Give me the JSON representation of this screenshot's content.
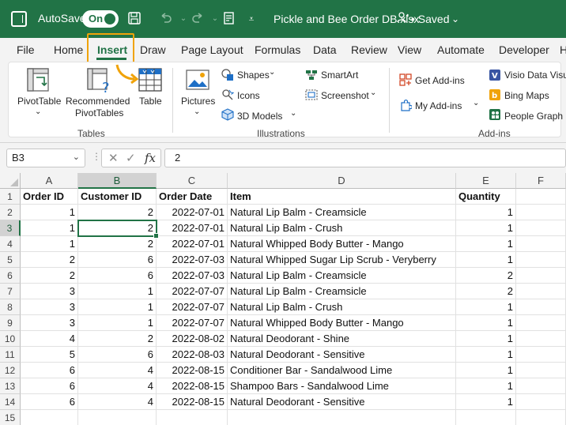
{
  "titlebar": {
    "autosave_label": "AutoSave",
    "autosave_toggle": "On",
    "filename": "Pickle and Bee Order DB.xlsx",
    "saved_label": "• Saved",
    "accent": "#217346"
  },
  "tabs": [
    "File",
    "Home",
    "Insert",
    "Draw",
    "Page Layout",
    "Formulas",
    "Data",
    "Review",
    "View",
    "Automate",
    "Developer",
    "He"
  ],
  "active_tab": "Insert",
  "ribbon": {
    "tables_group": {
      "label": "Tables",
      "pivottable": "PivotTable",
      "recommended_line1": "Recommended",
      "recommended_line2": "PivotTables",
      "table": "Table"
    },
    "illustrations_group": {
      "label": "Illustrations",
      "pictures": "Pictures",
      "shapes": "Shapes",
      "icons": "Icons",
      "models_3d": "3D Models",
      "smartart": "SmartArt",
      "screenshot": "Screenshot"
    },
    "addins_group": {
      "label": "Add-ins",
      "get_addins": "Get Add-ins",
      "my_addins": "My Add-ins",
      "visio": "Visio Data Visu",
      "bing_maps": "Bing Maps",
      "people_graph": "People Graph"
    }
  },
  "formula_bar": {
    "name_box": "B3",
    "formula_value": "2",
    "fx_label": "fx"
  },
  "sheet": {
    "columns": [
      "A",
      "B",
      "C",
      "D",
      "E",
      "F"
    ],
    "selected_column": "B",
    "selected_row": "3",
    "row_numbers": [
      "1",
      "2",
      "3",
      "4",
      "5",
      "6",
      "7",
      "8",
      "9",
      "10",
      "11",
      "12",
      "13",
      "14",
      "15"
    ],
    "headers": [
      "Order ID",
      "Customer ID",
      "Order Date",
      "Item",
      "Quantity"
    ],
    "rows": [
      [
        "1",
        "2",
        "2022-07-01",
        "Natural Lip Balm - Creamsicle",
        "1"
      ],
      [
        "1",
        "2",
        "2022-07-01",
        "Natural Lip Balm - Crush",
        "1"
      ],
      [
        "1",
        "2",
        "2022-07-01",
        "Natural Whipped Body Butter - Mango",
        "1"
      ],
      [
        "2",
        "6",
        "2022-07-03",
        "Natural Whipped Sugar Lip Scrub - Veryberry",
        "1"
      ],
      [
        "2",
        "6",
        "2022-07-03",
        "Natural Lip Balm - Creamsicle",
        "2"
      ],
      [
        "3",
        "1",
        "2022-07-07",
        "Natural Lip Balm - Creamsicle",
        "2"
      ],
      [
        "3",
        "1",
        "2022-07-07",
        "Natural Lip Balm - Crush",
        "1"
      ],
      [
        "3",
        "1",
        "2022-07-07",
        "Natural Whipped Body Butter - Mango",
        "1"
      ],
      [
        "4",
        "2",
        "2022-08-02",
        "Natural Deodorant - Shine",
        "1"
      ],
      [
        "5",
        "6",
        "2022-08-03",
        "Natural Deodorant - Sensitive",
        "1"
      ],
      [
        "6",
        "4",
        "2022-08-15",
        "Conditioner Bar - Sandalwood Lime",
        "1"
      ],
      [
        "6",
        "4",
        "2022-08-15",
        "Shampoo Bars - Sandalwood Lime",
        "1"
      ],
      [
        "6",
        "4",
        "2022-08-15",
        "Natural Deodorant - Sensitive",
        "1"
      ]
    ]
  }
}
